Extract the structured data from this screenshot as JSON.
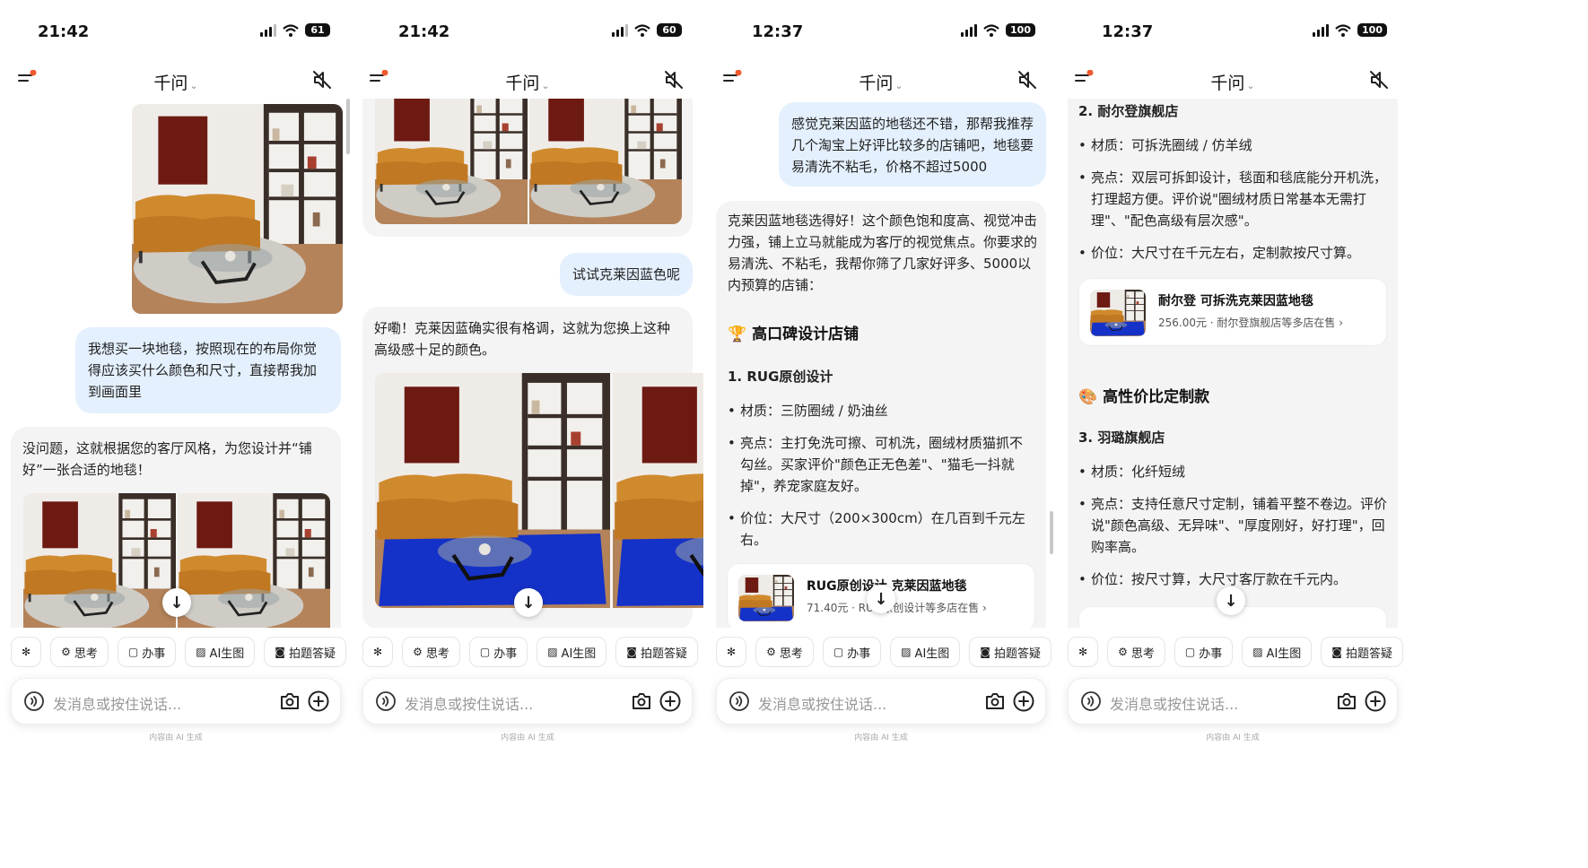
{
  "common": {
    "app_title": "千问",
    "input_placeholder": "发消息或按住说话...",
    "footer_note": "内容由 AI 生成",
    "chips": [
      {
        "icon": "asterisk-icon",
        "label": ""
      },
      {
        "icon": "think-icon",
        "label": "思考"
      },
      {
        "icon": "task-icon",
        "label": "办事"
      },
      {
        "icon": "image-gen-icon",
        "label": "AI生图"
      },
      {
        "icon": "camera-question-icon",
        "label": "拍题答疑"
      }
    ],
    "colors": {
      "accent_bubble": "#e4f0fd",
      "ai_bubble": "#f4f4f5",
      "rug_blue": "#1432c8",
      "notification_dot": "#ee5a2f"
    }
  },
  "screens": [
    {
      "time": "21:42",
      "battery": "61",
      "user_message": "我想买一块地毯，按照现在的布局你觉得应该买什么颜色和尺寸，直接帮我加到画面里",
      "ai_message": "没问题，这就根据您的客厅风格，为您设计并“铺好”一张合适的地毯！"
    },
    {
      "time": "21:42",
      "battery": "60",
      "user_message": "试试克莱因蓝色呢",
      "ai_message": "好嘞！克莱因蓝确实很有格调，这就为您换上这种高级感十足的颜色。"
    },
    {
      "time": "12:37",
      "battery": "100",
      "user_message": "感觉克莱因蓝的地毯还不错，那帮我推荐几个淘宝上好评比较多的店铺吧，地毯要易清洗不粘毛，价格不超过5000",
      "ai_intro": "克莱因蓝地毯选得好！这个颜色饱和度高、视觉冲击力强，铺上立马就能成为客厅的视觉焦点。你要求的易清洗、不粘毛，我帮你筛了几家好评多、5000以内预算的店铺：",
      "section_title": "🏆 高口碑设计店铺",
      "store_title": "1. RUG原创设计",
      "bullets": [
        "材质：三防圈绒 / 奶油丝",
        "亮点：主打免洗可擦、可机洗，圈绒材质猫抓不勾丝。买家评价\"颜色正无色差\"、\"猫毛一抖就掉\"，养宠家庭友好。",
        "价位：大尺寸（200×300cm）在几百到千元左右。"
      ],
      "product": {
        "name": "RUG原创设计 克莱因蓝地毯",
        "meta": "71.40元 · RUG原创设计等多店在售 ›"
      }
    },
    {
      "time": "12:37",
      "battery": "100",
      "store2_title": "2. 耐尔登旗舰店",
      "store2_bullets": [
        "材质：可拆洗圈绒 / 仿羊绒",
        "亮点：双层可拆卸设计，毯面和毯底能分开机洗，打理超方便。评价说\"圈绒材质日常基本无需打理\"、\"配色高级有层次感\"。",
        "价位：大尺寸在千元左右，定制款按尺寸算。"
      ],
      "product": {
        "name": "耐尔登 可拆洗克莱因蓝地毯",
        "meta": "256.00元 · 耐尔登旗舰店等多店在售 ›"
      },
      "section_title": "🎨 高性价比定制款",
      "store3_title": "3. 羽璐旗舰店",
      "store3_bullets": [
        "材质：化纤短绒",
        "亮点：支持任意尺寸定制，铺着平整不卷边。评价说\"颜色高级、无异味\"、\"厚度刚好，好打理\"，回购率高。",
        "价位：按尺寸算，大尺寸客厅款在千元内。"
      ]
    }
  ]
}
